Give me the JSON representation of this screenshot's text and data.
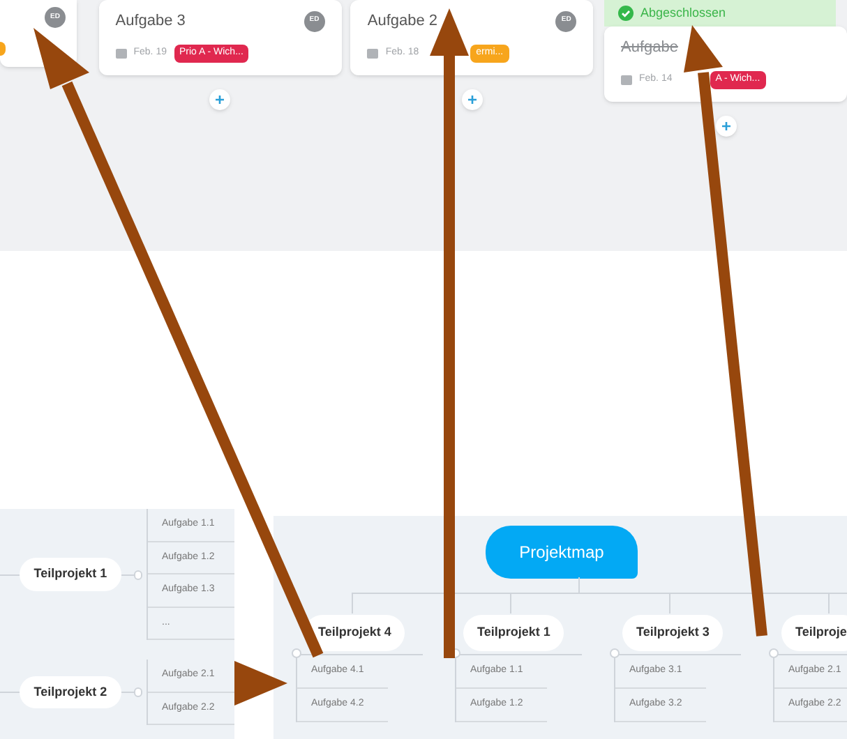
{
  "board": {
    "columns": [
      {
        "cards": [
          {
            "avatar": "ED",
            "color": "#f7a51c"
          }
        ]
      },
      {
        "cards": [
          {
            "title": "Aufgabe 3",
            "done": false,
            "avatar": "ED",
            "date": "Feb. 19",
            "tag": "Prio A - Wich...",
            "color": "#e0284f"
          }
        ]
      },
      {
        "cards": [
          {
            "title": "Aufgabe 2",
            "done": false,
            "avatar": "ED",
            "date": "Feb. 18",
            "tag": "ermi...",
            "color": "#f7a51c"
          }
        ]
      },
      {
        "header": "Abgeschlossen",
        "cards": [
          {
            "title": "Aufgabe",
            "done": true,
            "date": "Feb. 14",
            "tag": "A - Wich...",
            "color": "#e0284f"
          }
        ]
      }
    ]
  },
  "mindmap_left": {
    "branches": [
      {
        "label": "Teilprojekt 1",
        "children": [
          "Aufgabe 1.1",
          "Aufgabe 1.2",
          "Aufgabe 1.3",
          "..."
        ]
      },
      {
        "label": "Teilprojekt 2",
        "children": [
          "Aufgabe 2.1",
          "Aufgabe 2.2"
        ]
      }
    ]
  },
  "mindmap_right": {
    "root": "Projektmap",
    "branches": [
      {
        "label": "Teilprojekt 4",
        "children": [
          "Aufgabe 4.1",
          "Aufgabe 4.2"
        ]
      },
      {
        "label": "Teilprojekt 1",
        "children": [
          "Aufgabe 1.1",
          "Aufgabe 1.2"
        ]
      },
      {
        "label": "Teilprojekt 3",
        "children": [
          "Aufgabe 3.1",
          "Aufgabe 3.2"
        ]
      },
      {
        "label": "Teilproje",
        "children": [
          "Aufgabe 2.1",
          "Aufgabe 2.2"
        ]
      }
    ]
  }
}
